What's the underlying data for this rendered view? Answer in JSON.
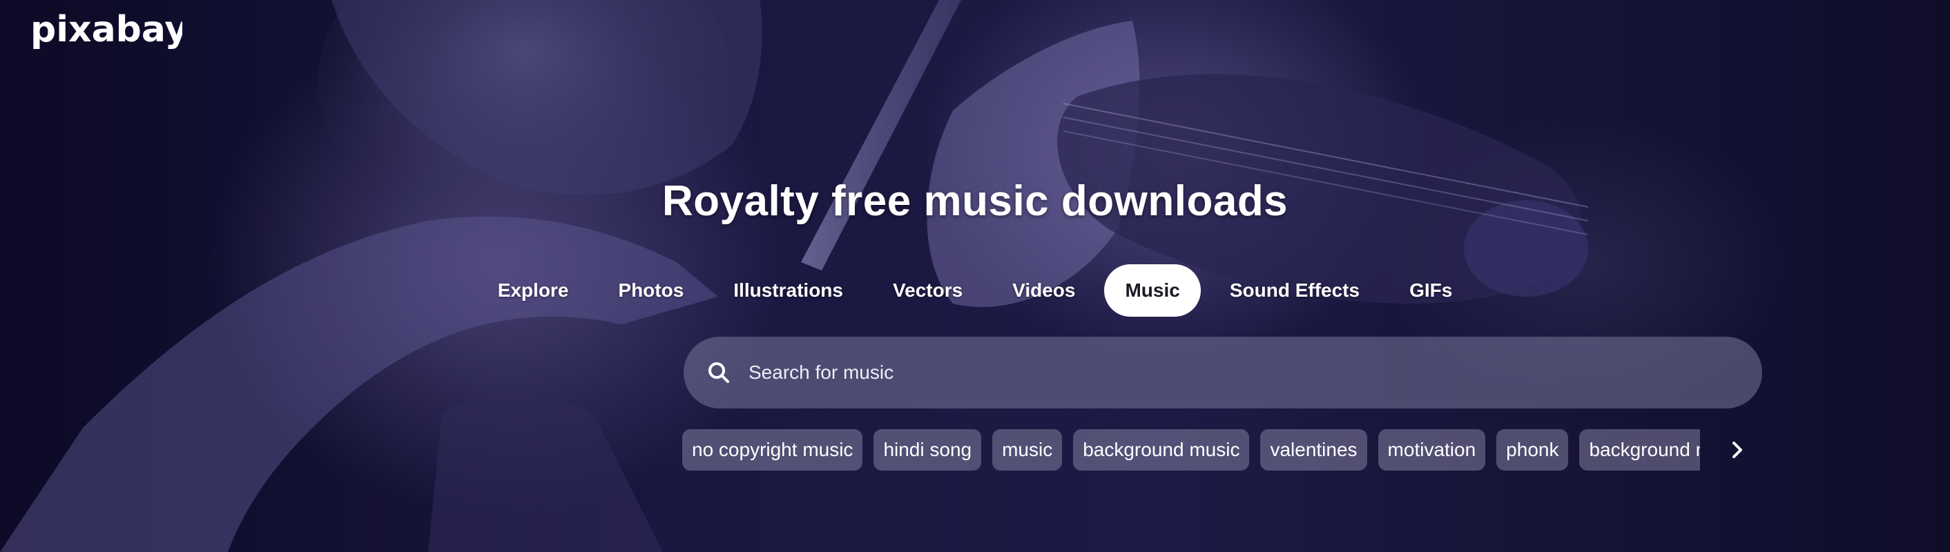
{
  "header": {
    "logo_text": "pixabay"
  },
  "hero": {
    "title": "Royalty free music downloads"
  },
  "tabs": [
    {
      "label": "Explore",
      "active": false
    },
    {
      "label": "Photos",
      "active": false
    },
    {
      "label": "Illustrations",
      "active": false
    },
    {
      "label": "Vectors",
      "active": false
    },
    {
      "label": "Videos",
      "active": false
    },
    {
      "label": "Music",
      "active": true
    },
    {
      "label": "Sound Effects",
      "active": false
    },
    {
      "label": "GIFs",
      "active": false
    }
  ],
  "search": {
    "placeholder": "Search for music",
    "value": ""
  },
  "suggestions": [
    "no copyright music",
    "hindi song",
    "music",
    "background music",
    "valentines",
    "motivation",
    "phonk",
    "background music"
  ],
  "icons": {
    "search": "search-icon",
    "next": "chevron-right-icon"
  },
  "colors": {
    "background": "#17153a",
    "active_tab_bg": "#ffffff",
    "active_tab_text": "#191b26",
    "search_bg": "rgba(120,118,155,0.55)"
  }
}
